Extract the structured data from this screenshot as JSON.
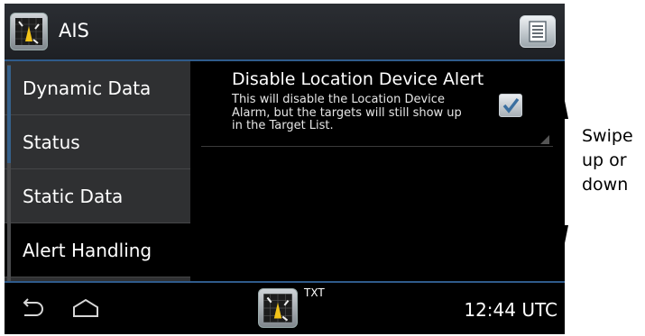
{
  "app": {
    "title": "AIS",
    "icon": "radar-app-icon"
  },
  "header": {
    "menu_icon": "menu-list-icon"
  },
  "sidebar": {
    "items": [
      {
        "label": "Dynamic Data",
        "active": false
      },
      {
        "label": "Status",
        "active": false
      },
      {
        "label": "Static Data",
        "active": false
      },
      {
        "label": "Alert Handling",
        "active": true
      }
    ]
  },
  "content": {
    "setting": {
      "title": "Disable Location Device Alert",
      "desc_line1": "This will disable the Location Device",
      "desc_line2": "Alarm, but the targets will still show up",
      "desc_line3": "in the Target List.",
      "checked": true
    }
  },
  "navbar": {
    "back_icon": "back-arrow-icon",
    "home_icon": "home-icon",
    "txt_label": "TXT",
    "clock": "12:44 UTC"
  },
  "annotation": {
    "line1": "Swipe",
    "line2": "up or",
    "line3": "down"
  },
  "colors": {
    "accent": "#2f5b8b",
    "checkmark": "#3a6fa0"
  }
}
